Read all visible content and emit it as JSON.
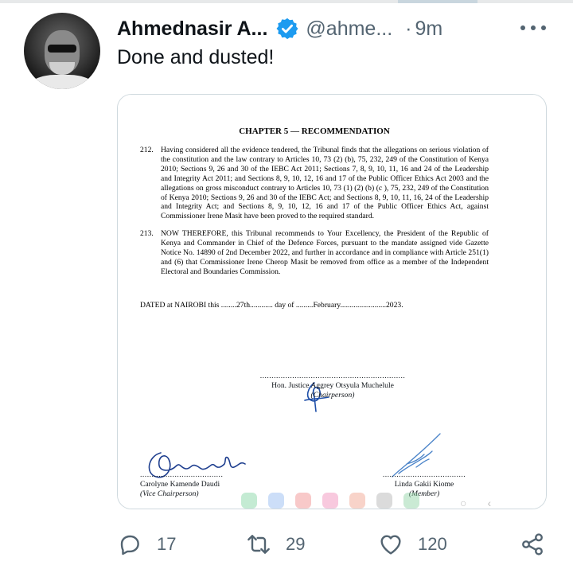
{
  "tweet": {
    "author_name": "Ahmednasir A...",
    "handle": "@ahme...",
    "separator": "·",
    "time": "9m",
    "text": "Done and dusted!"
  },
  "document": {
    "chapter_heading": "CHAPTER 5 — RECOMMENDATION",
    "para212_num": "212.",
    "para212": "Having considered all the evidence tendered, the Tribunal finds that the allegations on serious violation of the constitution and the law contrary to Articles 10, 73 (2) (b), 75, 232, 249 of the Constitution of Kenya 2010; Sections 9, 26 and 30 of the IEBC Act 2011; Sections 7, 8, 9, 10, 11, 16 and 24 of the Leadership and Integrity Act 2011; and Sections 8, 9, 10, 12, 16 and 17 of the Public Officer Ethics Act 2003 and the allegations on gross misconduct contrary to Articles 10, 73 (1) (2) (b) (c ), 75, 232, 249 of the Constitution of Kenya 2010; Sections 9, 26 and 30 of the IEBC Act; and Sections 8, 9, 10, 11, 16, 24 of the Leadership and Integrity Act; and Sections 8, 9, 10, 12, 16 and 17 of the Public Officer Ethics Act, against Commissioner Irene Masit have been proved to the required standard.",
    "para213_num": "213.",
    "para213": "NOW THEREFORE, this Tribunal recommends to Your Excellency, the President of the Republic of Kenya and Commander in Chief of the Defence Forces, pursuant to the mandate assigned vide Gazette Notice No. 14890 of 2nd December 2022, and further in accordance and in compliance with Article 251(1) and (6) that Commissioner Irene Cherop Masit be removed from office as a member of the Independent Electoral and Boundaries Commission.",
    "dated_line": "DATED at NAIROBI this ........27th............ day of .........February........................2023.",
    "sig_dots_long": "...............................................................",
    "sig_dots_short": "....................................",
    "chair_name": "Hon. Justice Aggrey Otsyula Muchelule",
    "chair_role": "(Chairperson)",
    "vice_name": "Carolyne Kamende Daudi",
    "vice_role": "(Vice Chairperson)",
    "member_name": "Linda Gakii Kiome",
    "member_role": "(Member)"
  },
  "actions": {
    "replies": "17",
    "retweets": "29",
    "likes": "120"
  },
  "colors": {
    "verified_blue": "#1d9bf0",
    "text_secondary": "#536471",
    "signature_ink": "#1f4fa8"
  },
  "icons": [
    "verified-badge-icon",
    "more-icon",
    "reply-icon",
    "retweet-icon",
    "like-icon",
    "share-icon"
  ]
}
